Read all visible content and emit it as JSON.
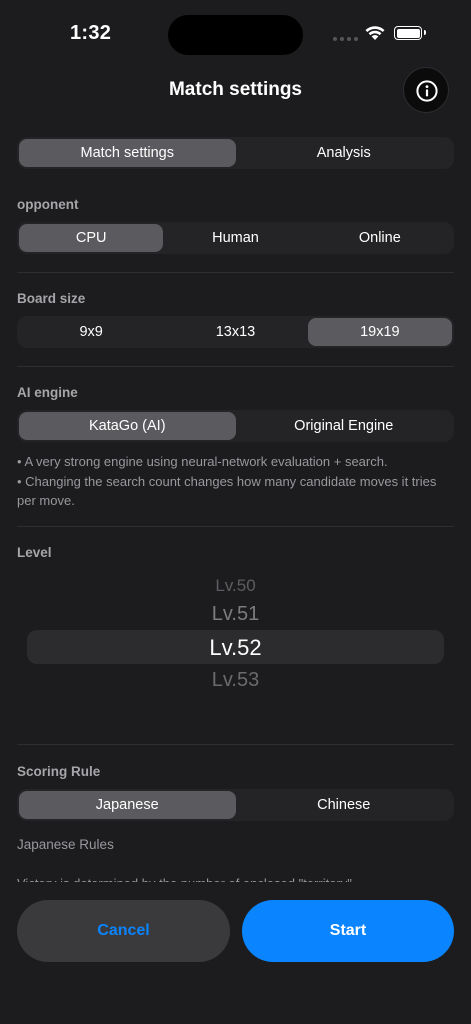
{
  "status_bar": {
    "time": "1:32"
  },
  "header": {
    "title": "Match settings",
    "info_icon": "info-circle-icon"
  },
  "main_tabs": [
    {
      "label": "Match settings",
      "selected": true
    },
    {
      "label": "Analysis",
      "selected": false
    }
  ],
  "opponent": {
    "label": "opponent",
    "options": [
      {
        "label": "CPU",
        "selected": true
      },
      {
        "label": "Human",
        "selected": false
      },
      {
        "label": "Online",
        "selected": false
      }
    ]
  },
  "board_size": {
    "label": "Board size",
    "options": [
      {
        "label": "9x9",
        "selected": false
      },
      {
        "label": "13x13",
        "selected": false
      },
      {
        "label": "19x19",
        "selected": true
      }
    ]
  },
  "ai_engine": {
    "label": "AI engine",
    "options": [
      {
        "label": "KataGo (AI)",
        "selected": true
      },
      {
        "label": "Original Engine",
        "selected": false
      }
    ],
    "note_line1": "• A very strong engine using neural-network evaluation + search.",
    "note_line2": "• Changing the search count changes how many candidate moves it tries per move."
  },
  "level": {
    "label": "Level",
    "picker": [
      "Lv.50",
      "Lv.51",
      "Lv.52",
      "Lv.53"
    ],
    "selected": "Lv.52"
  },
  "scoring": {
    "label": "Scoring Rule",
    "options": [
      {
        "label": "Japanese",
        "selected": true
      },
      {
        "label": "Chinese",
        "selected": false
      }
    ],
    "rule_name": "Japanese Rules",
    "cut_text": "Victory is determined by the number of enclosed \"territory\""
  },
  "actions": {
    "cancel": "Cancel",
    "start": "Start"
  },
  "colors": {
    "accent": "#0a84ff",
    "background": "#1c1c1e",
    "selected_segment": "#5b5b5f"
  }
}
